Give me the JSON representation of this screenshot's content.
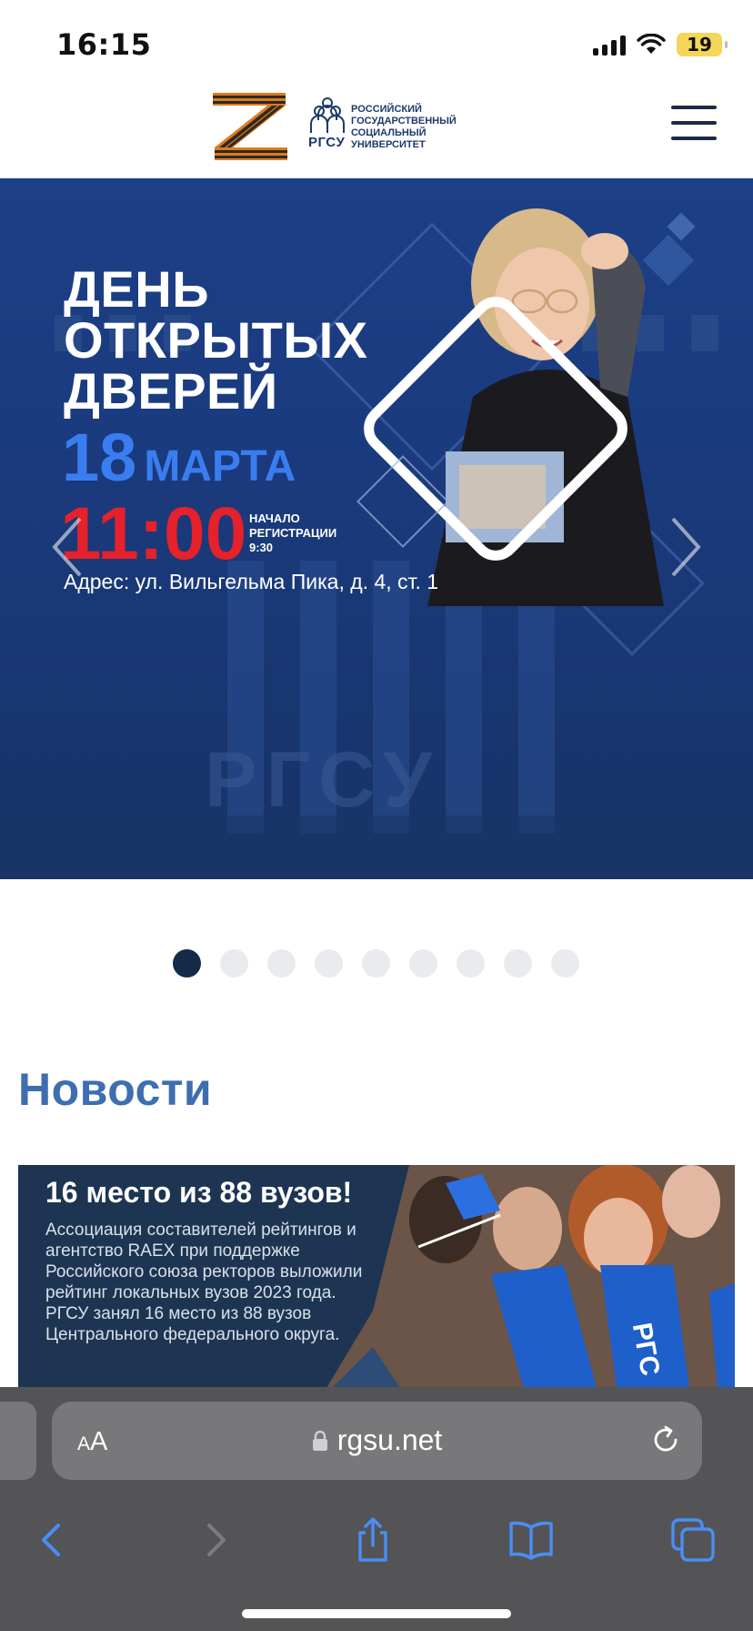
{
  "status_bar": {
    "time": "16:15",
    "battery": "19"
  },
  "header": {
    "univ_abbr": "РГСУ",
    "univ_name": "Российский государственный социальный университет"
  },
  "slide": {
    "title_line1": "ДЕНЬ",
    "title_line2": "ОТКРЫТЫХ",
    "title_line3": "ДВЕРЕЙ",
    "date_day": "18",
    "date_month": "МАРТА",
    "time": "11:00",
    "reg_line1": "НАЧАЛО",
    "reg_line2": "РЕГИСТРАЦИИ",
    "reg_time": "9:30",
    "address": "Адрес: ул. Вильгельма Пика, д. 4, ст. 1",
    "building_letters": "РГСУ"
  },
  "slider": {
    "total": 9,
    "active": 1
  },
  "news": {
    "heading": "Новости",
    "card_headline": "16 место из 88 вузов!",
    "card_text": "Ассоциация составителей рейтингов и агентство RAEX при поддержке Российского союза ректоров выложили рейтинг локальных вузов 2023 года. РГСУ занял 16 место из 88 вузов Центрального федерального округа.",
    "scarf_text": "РГС"
  },
  "browser": {
    "aa_small": "A",
    "aa_large": "A",
    "url": "rgsu.net"
  },
  "colors": {
    "accent_blue": "#3d6eb0",
    "slide_blue": "#1a3a7c",
    "date_blue": "#3a7df0",
    "time_red": "#e5212b",
    "dot_active": "#152a48",
    "dot_inactive": "#eaebef",
    "safari_bar": "#545456",
    "safari_accent": "#4a8ef5"
  },
  "icons": [
    "signal-icon",
    "wifi-icon",
    "battery-icon",
    "menu-icon",
    "chevron-left-icon",
    "chevron-right-icon",
    "lock-icon",
    "reload-icon",
    "back-icon",
    "forward-icon",
    "share-icon",
    "bookmarks-icon",
    "tabs-icon"
  ]
}
